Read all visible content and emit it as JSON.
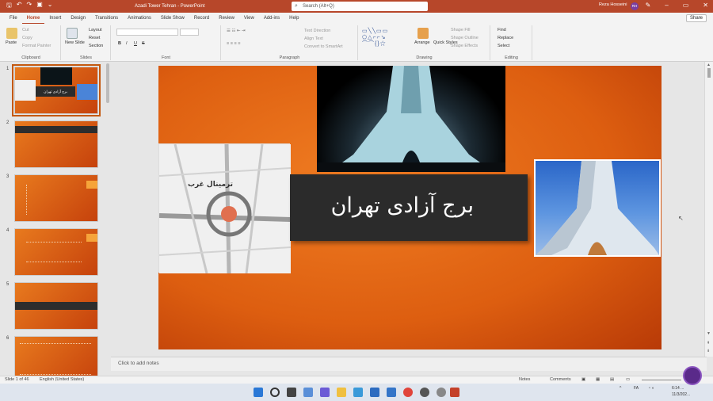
{
  "window": {
    "title": "Azadi Tower Tehran  -  PowerPoint",
    "search_placeholder": "Search (Alt+Q)",
    "user_name": "Reza Hosseini",
    "user_initials": "RH"
  },
  "tabs": [
    "File",
    "Home",
    "Insert",
    "Design",
    "Transitions",
    "Animations",
    "Slide Show",
    "Record",
    "Review",
    "View",
    "Add-ins",
    "Help"
  ],
  "share_label": "Share",
  "ribbon": {
    "clipboard": {
      "group": "Clipboard",
      "paste": "Paste",
      "cut": "Cut",
      "copy": "Copy",
      "format_painter": "Format Painter"
    },
    "slides": {
      "group": "Slides",
      "new_slide": "New Slide",
      "layout": "Layout",
      "reset": "Reset",
      "section": "Section"
    },
    "font": {
      "group": "Font",
      "bold": "B",
      "italic": "I",
      "underline": "U",
      "strike": "S"
    },
    "paragraph": {
      "group": "Paragraph",
      "text_direction": "Text Direction",
      "align_text": "Align Text",
      "smartart": "Convert to SmartArt"
    },
    "drawing": {
      "group": "Drawing",
      "arrange": "Arrange",
      "quick_styles": "Quick Styles",
      "shape_fill": "Shape Fill",
      "shape_outline": "Shape Outline",
      "shape_effects": "Shape Effects"
    },
    "editing": {
      "group": "Editing",
      "find": "Find",
      "replace": "Replace",
      "select": "Select"
    }
  },
  "slides_panel": {
    "numbers": [
      "1",
      "2",
      "3",
      "4",
      "5",
      "6"
    ],
    "thumb1_title": "برج آزادی تهران"
  },
  "slide": {
    "title": "برج آزادی تهران",
    "map_label": "ترمینال غرب"
  },
  "notes_placeholder": "Click to add notes",
  "status": {
    "slide_of": "Slide 1 of 46",
    "language": "English (United States)",
    "notes": "Notes",
    "comments": "Comments"
  },
  "tray": {
    "lang": "FA",
    "time": "6:14 ...",
    "date": "11/3/202..."
  },
  "colors": {
    "accent": "#b7472a",
    "slide_orange": "#e46a14",
    "title_box": "#2b2b2b"
  }
}
